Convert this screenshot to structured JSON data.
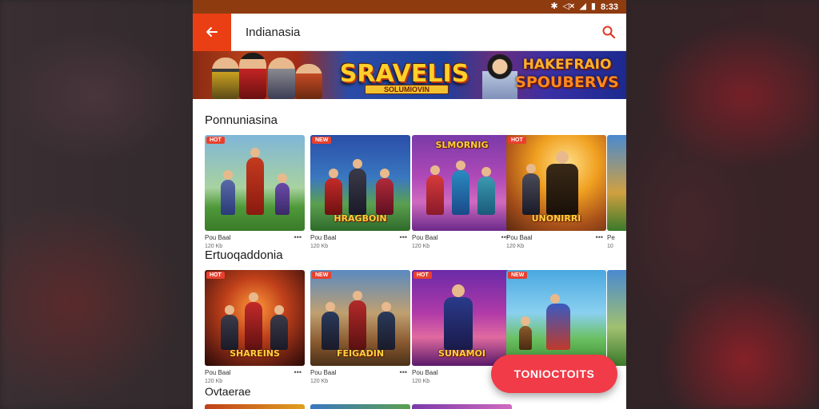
{
  "status_bar": {
    "time": "8:33",
    "icons": [
      "bluetooth-icon",
      "mute-icon",
      "signal-icon",
      "battery-icon"
    ]
  },
  "app_bar": {
    "title": "Indianasia",
    "back_icon": "arrow-left-icon",
    "search_icon": "search-icon"
  },
  "banner": {
    "logo_left": "SRAVELIS",
    "logo_left_sub": "SOLUMIOVIN",
    "logo_right_line1": "HAKEFRAIO",
    "logo_right_line2": "SPOUBERVS"
  },
  "sections": [
    {
      "title": "Ponnuniasina",
      "cards": [
        {
          "badge": "HOT",
          "thumb_title": "",
          "name": "Pou Baal",
          "size": "120 Kb"
        },
        {
          "badge": "NEW",
          "thumb_title": "HRAGBOIN",
          "name": "Pou Baal",
          "size": "120 Kb"
        },
        {
          "badge": "",
          "thumb_title": "SLMORNIG",
          "name": "Pou Baal",
          "size": "120 Kb"
        },
        {
          "badge": "HOT",
          "thumb_title": "UNONIRRI",
          "name": "Pou Baal",
          "size": "120 Kb"
        },
        {
          "badge": "",
          "thumb_title": "",
          "name": "Pe",
          "size": "10"
        }
      ]
    },
    {
      "title": "Ertuoqaddonia",
      "cards": [
        {
          "badge": "HOT",
          "thumb_title": "SHAREINS",
          "name": "Pou Baal",
          "size": "120 Kb"
        },
        {
          "badge": "NEW",
          "thumb_title": "FEIGADIN",
          "name": "Pou Baal",
          "size": "120 Kb"
        },
        {
          "badge": "HOT",
          "thumb_title": "SUNAMOI",
          "name": "Pou Baal",
          "size": "120 Kb"
        },
        {
          "badge": "NEW",
          "thumb_title": "",
          "name": "",
          "size": ""
        },
        {
          "badge": "",
          "thumb_title": "",
          "name": "",
          "size": ""
        }
      ]
    },
    {
      "title": "Ovtaerae",
      "cards": []
    }
  ],
  "fab": {
    "label": "TONIOCTOITS"
  },
  "colors": {
    "status_bar": "#8f3b10",
    "accent": "#ea3f14",
    "fab": "#f23b48"
  }
}
